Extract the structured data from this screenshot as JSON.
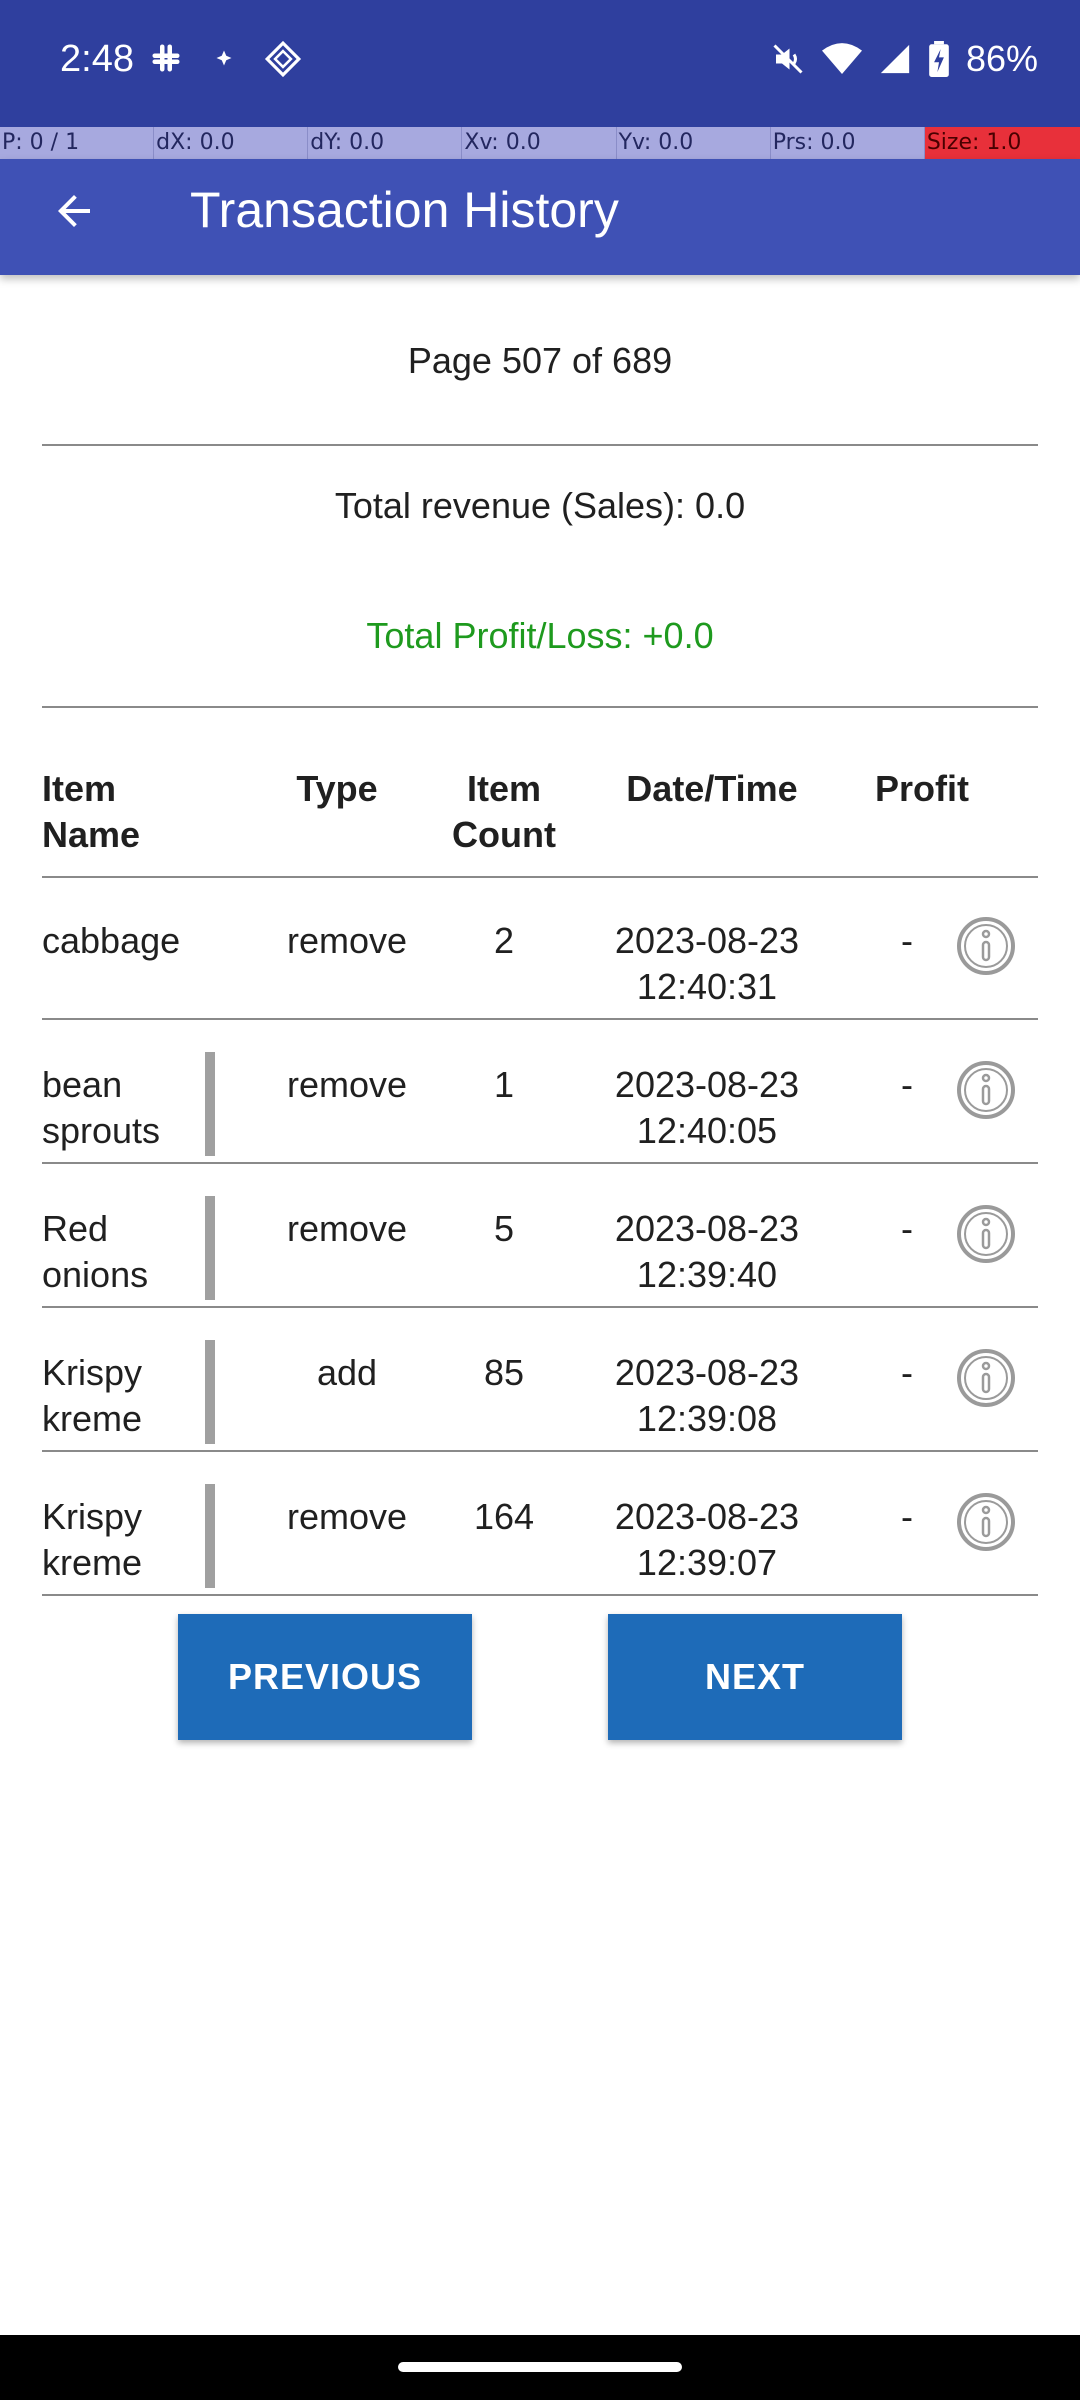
{
  "status_bar": {
    "time": "2:48",
    "left_icons": [
      "slack-icon",
      "sparkle-icon",
      "diamond-icon"
    ],
    "right_icons": [
      "mute-icon",
      "wifi-icon",
      "signal-icon",
      "battery-charging-icon"
    ],
    "battery": "86%"
  },
  "debug_bar": {
    "cells": [
      "P: 0 / 1",
      "dX: 0.0",
      "dY: 0.0",
      "Xv: 0.0",
      "Yv: 0.0",
      "Prs: 0.0",
      "Size: 1.0"
    ]
  },
  "app_bar": {
    "title": "Transaction History",
    "back_icon": "arrow-left-icon"
  },
  "page_indicator": "Page 507 of 689",
  "summary": {
    "revenue": "Total revenue (Sales): 0.0",
    "profit": "Total Profit/Loss: +0.0",
    "profit_color": "#1e9a1e"
  },
  "table": {
    "headers": {
      "name": "Item Name",
      "type": "Type",
      "count": "Item Count",
      "date": "Date/Time",
      "profit": "Profit"
    },
    "rows": [
      {
        "name": "cabbage",
        "type": "remove",
        "count": "2",
        "date": "2023-08-23 12:40:31",
        "profit": "-"
      },
      {
        "name": "bean sprouts",
        "type": "remove",
        "count": "1",
        "date": "2023-08-23 12:40:05",
        "profit": "-"
      },
      {
        "name": "Red onions",
        "type": "remove",
        "count": "5",
        "date": "2023-08-23 12:39:40",
        "profit": "-"
      },
      {
        "name": "Krispy kreme",
        "type": "add",
        "count": "85",
        "date": "2023-08-23 12:39:08",
        "profit": "-"
      },
      {
        "name": "Krispy kreme",
        "type": "remove",
        "count": "164",
        "date": "2023-08-23 12:39:07",
        "profit": "-"
      }
    ]
  },
  "buttons": {
    "previous": "PREVIOUS",
    "next": "NEXT"
  },
  "colors": {
    "status_bar": "#2f3f9e",
    "app_bar": "#3f51b5",
    "button": "#1e6bb8"
  }
}
